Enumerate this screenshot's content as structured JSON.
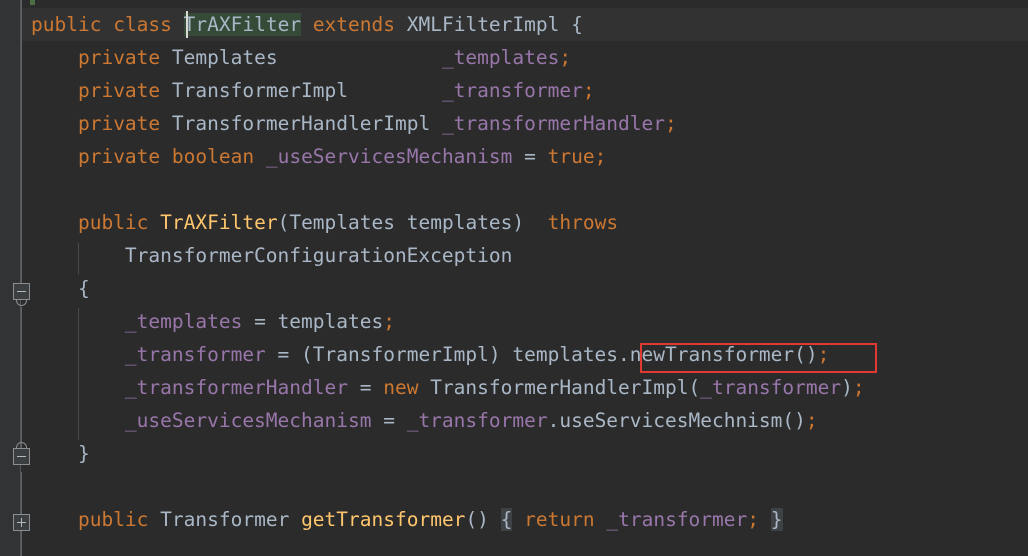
{
  "app": {
    "kind": "code-editor",
    "language": "Java",
    "theme": "darcula"
  },
  "colors": {
    "background": "#2b2b2b",
    "caret_line": "#323232",
    "gutter": "#313335",
    "keyword": "#cc7832",
    "identifier": "#a9b7c6",
    "field": "#9876aa",
    "method_declaration": "#ffc66d",
    "selection": "#354b37",
    "fold_placeholder": "#3f4244",
    "highlight_box": "#e03a32",
    "vcs_added": "#4f6d42",
    "indent_guide": "#4b4b4b"
  },
  "gutter": {
    "vcs_marker_present": true,
    "fold_markers": [
      {
        "name": "fold-region-start",
        "glyph": "minus",
        "line": 8
      },
      {
        "name": "fold-region-end",
        "glyph": "minus",
        "line": 13
      },
      {
        "name": "fold-collapsed",
        "glyph": "plus",
        "line": 15
      }
    ]
  },
  "selection": {
    "text": "TrAXFilter",
    "caret_visible": true
  },
  "highlight_box": {
    "label": "newTransformer();",
    "line": 11
  },
  "code": {
    "lines": [
      {
        "n": 1,
        "current": true,
        "tokens": [
          {
            "t": "public",
            "c": "kw"
          },
          {
            "t": " ",
            "c": "pun"
          },
          {
            "t": "class",
            "c": "kw"
          },
          {
            "t": " ",
            "c": "pun"
          },
          {
            "t": "TrAXFilter",
            "c": "typ",
            "selected": true
          },
          {
            "t": " ",
            "c": "pun"
          },
          {
            "t": "extends",
            "c": "kw"
          },
          {
            "t": " ",
            "c": "pun"
          },
          {
            "t": "XMLFilterImpl",
            "c": "typ"
          },
          {
            "t": " ",
            "c": "pun"
          },
          {
            "t": "{",
            "c": "brc"
          }
        ]
      },
      {
        "n": 2,
        "tokens": [
          {
            "t": "    ",
            "c": "pun"
          },
          {
            "t": "private",
            "c": "kw"
          },
          {
            "t": " ",
            "c": "pun"
          },
          {
            "t": "Templates",
            "c": "typ"
          },
          {
            "t": "              ",
            "c": "pun"
          },
          {
            "t": "_templates",
            "c": "fld"
          },
          {
            "t": ";",
            "c": "semi"
          }
        ]
      },
      {
        "n": 3,
        "tokens": [
          {
            "t": "    ",
            "c": "pun"
          },
          {
            "t": "private",
            "c": "kw"
          },
          {
            "t": " ",
            "c": "pun"
          },
          {
            "t": "TransformerImpl",
            "c": "typ"
          },
          {
            "t": "        ",
            "c": "pun"
          },
          {
            "t": "_transformer",
            "c": "fld"
          },
          {
            "t": ";",
            "c": "semi"
          }
        ]
      },
      {
        "n": 4,
        "tokens": [
          {
            "t": "    ",
            "c": "pun"
          },
          {
            "t": "private",
            "c": "kw"
          },
          {
            "t": " ",
            "c": "pun"
          },
          {
            "t": "TransformerHandlerImpl",
            "c": "typ"
          },
          {
            "t": " ",
            "c": "pun"
          },
          {
            "t": "_transformerHandler",
            "c": "fld"
          },
          {
            "t": ";",
            "c": "semi"
          }
        ]
      },
      {
        "n": 5,
        "tokens": [
          {
            "t": "    ",
            "c": "pun"
          },
          {
            "t": "private",
            "c": "kw"
          },
          {
            "t": " ",
            "c": "pun"
          },
          {
            "t": "boolean",
            "c": "kw"
          },
          {
            "t": " ",
            "c": "pun"
          },
          {
            "t": "_useServicesMechanism",
            "c": "fld"
          },
          {
            "t": " = ",
            "c": "pun"
          },
          {
            "t": "true",
            "c": "kw"
          },
          {
            "t": ";",
            "c": "semi"
          }
        ]
      },
      {
        "n": 6,
        "tokens": []
      },
      {
        "n": 7,
        "tokens": [
          {
            "t": "    ",
            "c": "pun"
          },
          {
            "t": "public",
            "c": "kw"
          },
          {
            "t": " ",
            "c": "pun"
          },
          {
            "t": "TrAXFilter",
            "c": "mtd"
          },
          {
            "t": "(",
            "c": "pun"
          },
          {
            "t": "Templates",
            "c": "typ"
          },
          {
            "t": " ",
            "c": "pun"
          },
          {
            "t": "templates",
            "c": "typ"
          },
          {
            "t": ")  ",
            "c": "pun"
          },
          {
            "t": "throws",
            "c": "kw"
          }
        ]
      },
      {
        "n": 8,
        "tokens": [
          {
            "t": "        ",
            "c": "pun"
          },
          {
            "t": "TransformerConfigurationException",
            "c": "typ"
          }
        ]
      },
      {
        "n": 9,
        "tokens": [
          {
            "t": "    ",
            "c": "pun"
          },
          {
            "t": "{",
            "c": "brc"
          }
        ]
      },
      {
        "n": 10,
        "tokens": [
          {
            "t": "        ",
            "c": "pun"
          },
          {
            "t": "_templates",
            "c": "fld"
          },
          {
            "t": " = ",
            "c": "pun"
          },
          {
            "t": "templates",
            "c": "typ"
          },
          {
            "t": ";",
            "c": "semi"
          }
        ]
      },
      {
        "n": 11,
        "tokens": [
          {
            "t": "        ",
            "c": "pun"
          },
          {
            "t": "_transformer",
            "c": "fld"
          },
          {
            "t": " = (",
            "c": "pun"
          },
          {
            "t": "TransformerImpl",
            "c": "typ"
          },
          {
            "t": ") ",
            "c": "pun"
          },
          {
            "t": "templates",
            "c": "typ"
          },
          {
            "t": ".",
            "c": "pun"
          },
          {
            "t": "newTransformer",
            "c": "typ"
          },
          {
            "t": "()",
            "c": "pun"
          },
          {
            "t": ";",
            "c": "semi"
          }
        ]
      },
      {
        "n": 12,
        "tokens": [
          {
            "t": "        ",
            "c": "pun"
          },
          {
            "t": "_transformerHandler",
            "c": "fld"
          },
          {
            "t": " = ",
            "c": "pun"
          },
          {
            "t": "new",
            "c": "kw"
          },
          {
            "t": " ",
            "c": "pun"
          },
          {
            "t": "TransformerHandlerImpl",
            "c": "typ"
          },
          {
            "t": "(",
            "c": "pun"
          },
          {
            "t": "_transformer",
            "c": "fld"
          },
          {
            "t": ")",
            "c": "pun"
          },
          {
            "t": ";",
            "c": "semi"
          }
        ]
      },
      {
        "n": 13,
        "tokens": [
          {
            "t": "        ",
            "c": "pun"
          },
          {
            "t": "_useServicesMechanism",
            "c": "fld"
          },
          {
            "t": " = ",
            "c": "pun"
          },
          {
            "t": "_transformer",
            "c": "fld"
          },
          {
            "t": ".",
            "c": "pun"
          },
          {
            "t": "useServicesMechnism",
            "c": "typ"
          },
          {
            "t": "()",
            "c": "pun"
          },
          {
            "t": ";",
            "c": "semi"
          }
        ]
      },
      {
        "n": 14,
        "tokens": [
          {
            "t": "    ",
            "c": "pun"
          },
          {
            "t": "}",
            "c": "brc"
          }
        ]
      },
      {
        "n": 15,
        "tokens": []
      },
      {
        "n": 16,
        "tokens": [
          {
            "t": "    ",
            "c": "pun"
          },
          {
            "t": "public",
            "c": "kw"
          },
          {
            "t": " ",
            "c": "pun"
          },
          {
            "t": "Transformer",
            "c": "typ"
          },
          {
            "t": " ",
            "c": "pun"
          },
          {
            "t": "getTransformer",
            "c": "mtd"
          },
          {
            "t": "()",
            "c": "pun"
          },
          {
            "t": " ",
            "c": "pun"
          },
          {
            "t": "{",
            "c": "brc",
            "folded": true
          },
          {
            "t": " ",
            "c": "pun"
          },
          {
            "t": "return",
            "c": "kw"
          },
          {
            "t": " ",
            "c": "pun"
          },
          {
            "t": "_transformer",
            "c": "fld"
          },
          {
            "t": ";",
            "c": "semi"
          },
          {
            "t": " ",
            "c": "pun"
          },
          {
            "t": "}",
            "c": "brc",
            "folded": true
          }
        ]
      }
    ]
  }
}
